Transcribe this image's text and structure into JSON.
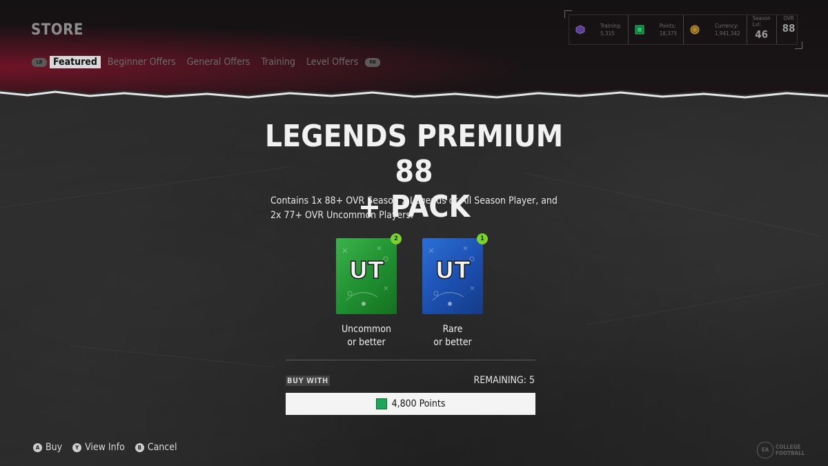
{
  "header": {
    "title": "STORE",
    "left_bumper": "LB",
    "right_bumper": "RB",
    "tabs": [
      {
        "label": "Featured",
        "active": true
      },
      {
        "label": "Beginner Offers",
        "active": false
      },
      {
        "label": "General Offers",
        "active": false
      },
      {
        "label": "Training",
        "active": false
      },
      {
        "label": "Level Offers",
        "active": false
      }
    ]
  },
  "stats": {
    "training": {
      "label": "Training:",
      "value": "5,315"
    },
    "points": {
      "label": "Points:",
      "value": "18,375"
    },
    "currency": {
      "label": "Currency:",
      "value": "1,941,342"
    },
    "season_level": {
      "label": "Season Lvl:",
      "value": "46"
    },
    "ovr": {
      "label": "OVR",
      "value": "88"
    }
  },
  "pack": {
    "title_line1": "LEGENDS PREMIUM 88",
    "title_line2": "+ PACK",
    "description": "Contains 1x 88+ OVR Season 2 Legends or All Season Player, and 2x 77+ OVR Uncommon Players.",
    "cards": [
      {
        "count": "2",
        "label_line1": "Uncommon",
        "label_line2": "or better",
        "color": "#2aa13c"
      },
      {
        "count": "1",
        "label_line1": "Rare",
        "label_line2": "or better",
        "color": "#2360c4"
      }
    ],
    "buy_with_label": "BUY WITH",
    "remaining": "REMAINING: 5",
    "price": "4,800 Points"
  },
  "footer": {
    "actions": [
      {
        "button": "A",
        "label": "Buy"
      },
      {
        "button": "Y",
        "label": "View Info"
      },
      {
        "button": "B",
        "label": "Cancel"
      }
    ]
  },
  "brand": {
    "mark": "EA",
    "line1": "COLLEGE",
    "line2": "FOOTBALL"
  },
  "colors": {
    "accent_green": "#7cd12b",
    "header_red": "#8c142d",
    "points_green": "#1ea65a"
  }
}
